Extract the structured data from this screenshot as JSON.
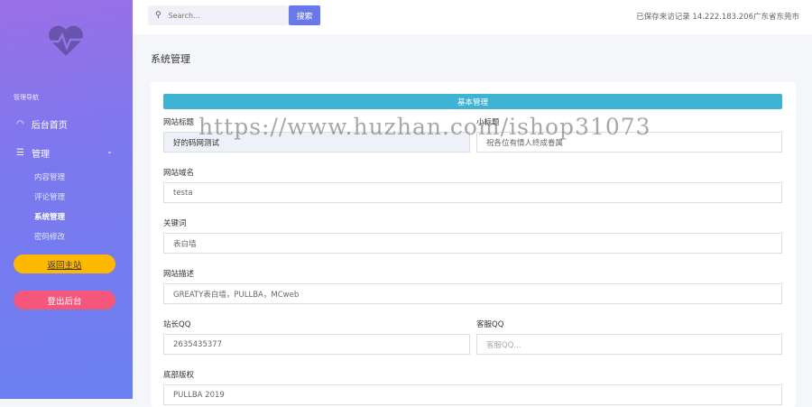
{
  "sidebar": {
    "nav_header": "管理导航",
    "home": "后台首页",
    "manage": "管理",
    "sub_items": [
      "内容管理",
      "评论管理",
      "系统管理",
      "密码修改"
    ],
    "back_button": "返回主站",
    "logout_button": "登出后台"
  },
  "header": {
    "search_placeholder": "Search...",
    "search_button": "搜索",
    "visit_info": "已保存来访记录 14.222.183.206广东省东莞市"
  },
  "page": {
    "title": "系统管理"
  },
  "form": {
    "section": "基本管理",
    "site_title_label": "网站标题",
    "site_title_value": "好的码网测试",
    "subtitle_label": "小标题",
    "subtitle_value": "祝各位有情人终成眷属",
    "domain_label": "网站域名",
    "domain_value": "testa",
    "keywords_label": "关键词",
    "keywords_value": "表白墙",
    "desc_label": "网站描述",
    "desc_value": "GREATY表白墙，PULLBA，MCweb",
    "owner_qq_label": "站长QQ",
    "owner_qq_value": "2635435377",
    "service_qq_label": "客服QQ",
    "service_qq_placeholder": "客服QQ...",
    "copyright_label": "底部版权",
    "copyright_value": "PULLBA 2019"
  },
  "watermark": "https://www.huzhan.com/ishop31073",
  "colors": {
    "accent": "#6a79ea",
    "section": "#3fb3d3",
    "back": "#ffb800",
    "logout": "#f5577c"
  }
}
